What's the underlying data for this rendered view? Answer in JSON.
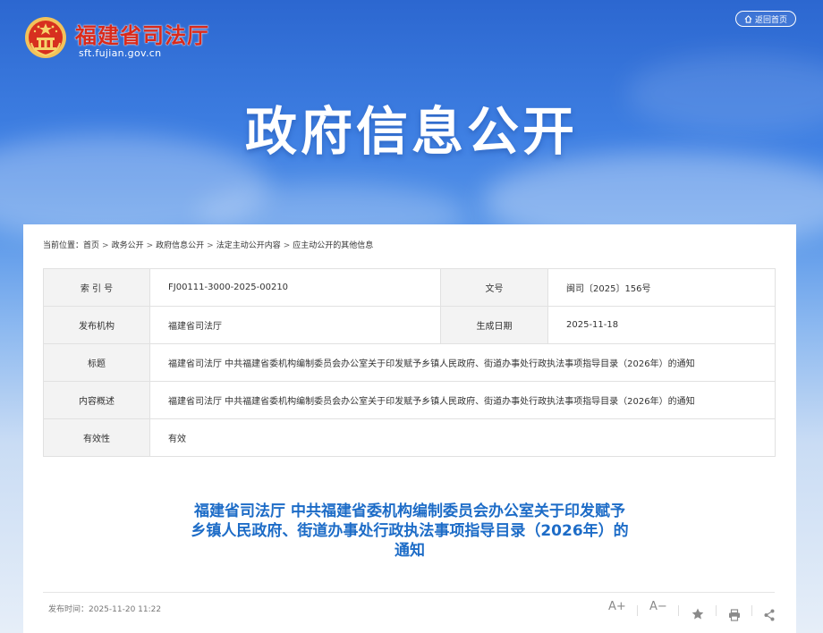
{
  "header": {
    "site_name": "福建省司法厅",
    "site_domain": "sft.fujian.gov.cn",
    "back_home_label": "返回首页",
    "banner_title": "政府信息公开"
  },
  "breadcrumb": {
    "prefix": "当前位置：",
    "items": [
      "首页",
      "政务公开",
      "政府信息公开",
      "法定主动公开内容",
      "应主动公开的其他信息"
    ],
    "separator": ">"
  },
  "meta": {
    "index_label": "索 引 号",
    "index_value": "FJ00111-3000-2025-00210",
    "docno_label": "文号",
    "docno_value": "闽司〔2025〕156号",
    "publisher_label": "发布机构",
    "publisher_value": "福建省司法厅",
    "date_label": "生成日期",
    "date_value": "2025-11-18",
    "title_label": "标题",
    "title_value": "福建省司法厅 中共福建省委机构编制委员会办公室关于印发赋予乡镇人民政府、街道办事处行政执法事项指导目录（2026年）的通知",
    "summary_label": "内容概述",
    "summary_value": "福建省司法厅 中共福建省委机构编制委员会办公室关于印发赋予乡镇人民政府、街道办事处行政执法事项指导目录（2026年）的通知",
    "validity_label": "有效性",
    "validity_value": "有效"
  },
  "article": {
    "title_line1": "福建省司法厅 中共福建省委机构编制委员会办公室关于印发赋予",
    "title_line2": "乡镇人民政府、街道办事处行政执法事项指导目录（2026年）的",
    "title_line3": "通知",
    "publish_time": "发布时间：2025-11-20 11:22"
  },
  "tools": {
    "font_increase": "A+",
    "font_decrease": "A−",
    "favorite_icon": "star-icon",
    "print_icon": "printer-icon",
    "share_icon": "share-icon"
  },
  "colors": {
    "brand_red": "#d92a1c",
    "title_blue": "#1d6cc7",
    "sky_blue": "#3f80e3"
  }
}
